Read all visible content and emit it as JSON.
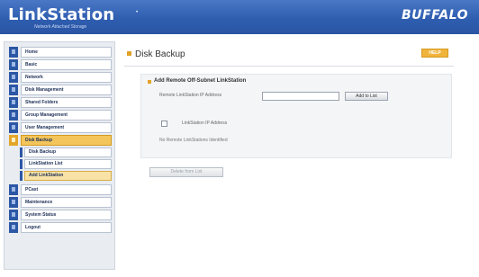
{
  "header": {
    "brand": "LinkStation",
    "brand_subtitle": "Network Attached Storage",
    "vendor": "BUFFALO"
  },
  "sidebar": {
    "items": [
      {
        "label": "Home"
      },
      {
        "label": "Basic"
      },
      {
        "label": "Network"
      },
      {
        "label": "Disk Management"
      },
      {
        "label": "Shared Folders"
      },
      {
        "label": "Group Management"
      },
      {
        "label": "User Management"
      },
      {
        "label": "Disk Backup"
      },
      {
        "label": "PCast"
      },
      {
        "label": "Maintenance"
      },
      {
        "label": "System Status"
      },
      {
        "label": "Logout"
      }
    ],
    "subitems": [
      {
        "label": "Disk Backup"
      },
      {
        "label": "LinkStation List"
      },
      {
        "label": "Add LinkStation"
      }
    ]
  },
  "main": {
    "title": "Disk Backup",
    "help_label": "HELP",
    "section_title": "Add Remote Off-Subnet LinkStation",
    "ip_label": "Remote LinkStation IP Address",
    "ip_value": "",
    "add_button": "Add to List",
    "column_header": "LinkStation IP Address",
    "empty_message": "No Remote LinkStations Identified",
    "remove_button": "Delete from List"
  }
}
